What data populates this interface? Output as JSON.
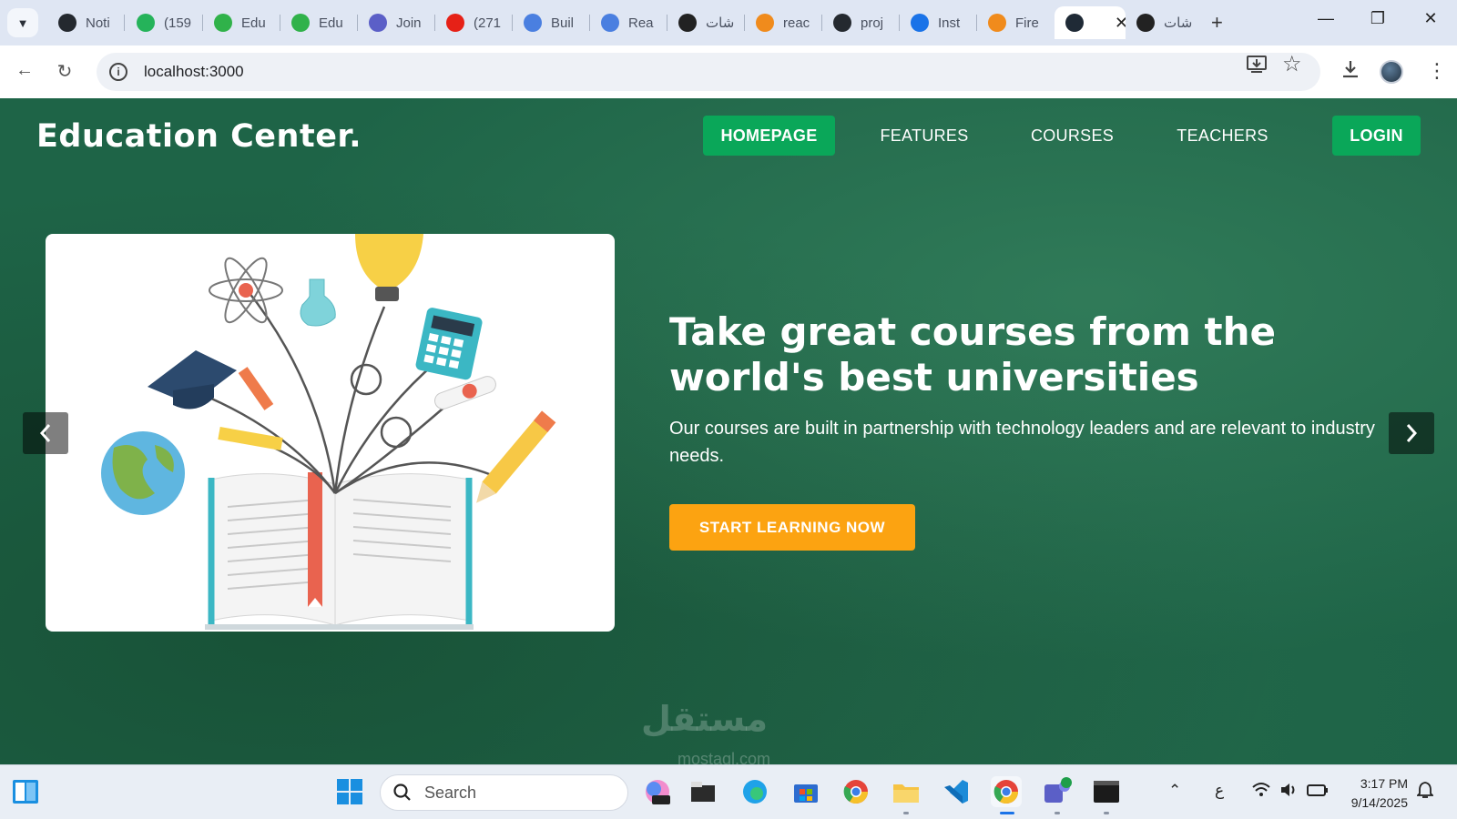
{
  "browser": {
    "tabs": [
      {
        "label": "Noti",
        "icon": "github-icon",
        "color": "#24292f"
      },
      {
        "label": "(159",
        "icon": "chat-icon",
        "color": "#25b35a"
      },
      {
        "label": "Edu",
        "icon": "bolt-icon",
        "color": "#30b24a"
      },
      {
        "label": "Edu",
        "icon": "bolt-icon",
        "color": "#30b24a"
      },
      {
        "label": "Join",
        "icon": "teams-icon",
        "color": "#5b5fc7"
      },
      {
        "label": "(271",
        "icon": "youtube-icon",
        "color": "#e62117"
      },
      {
        "label": "Buil",
        "icon": "doc-icon",
        "color": "#4a7fe0"
      },
      {
        "label": "Rea",
        "icon": "doc-icon",
        "color": "#4a7fe0"
      },
      {
        "label": "شات",
        "icon": "openai-icon",
        "color": "#222222"
      },
      {
        "label": "reac",
        "icon": "fire-icon",
        "color": "#f08b1c"
      },
      {
        "label": "proj",
        "icon": "github-icon",
        "color": "#24292f"
      },
      {
        "label": "Inst",
        "icon": "mui-icon",
        "color": "#1a73e8"
      },
      {
        "label": "Fire",
        "icon": "fire-icon",
        "color": "#f08b1c"
      },
      {
        "label": "",
        "icon": "react-icon",
        "color": "#1f2a36",
        "active": true
      },
      {
        "label": "شات",
        "icon": "openai-icon",
        "color": "#222222"
      }
    ],
    "url": "localhost:3000"
  },
  "site": {
    "brand": "Education Center.",
    "nav": {
      "homepage": "HOMEPAGE",
      "features": "FEATURES",
      "courses": "COURSES",
      "teachers": "TEACHERS",
      "login": "LOGIN"
    },
    "hero": {
      "title": "Take great courses from the world's best universities",
      "text": "Our courses are built in partnership with technology leaders and are relevant to industry needs.",
      "cta": "START LEARNING NOW"
    },
    "colors": {
      "accent": "#0aa759",
      "cta": "#fca311",
      "background": "#1e6447"
    }
  },
  "watermark": {
    "main": "مستقل",
    "sub": "mostaql.com"
  },
  "taskbar": {
    "search_placeholder": "Search",
    "ime": "ع",
    "time": "3:17 PM",
    "date": "9/14/2025"
  }
}
